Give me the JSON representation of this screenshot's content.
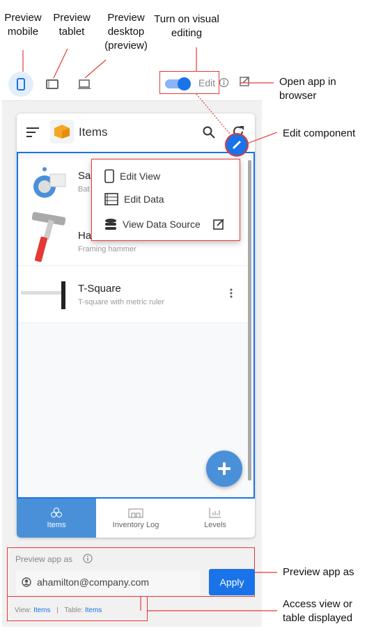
{
  "annotations": {
    "preview_mobile": "Preview mobile",
    "preview_tablet": "Preview tablet",
    "preview_desktop": "Preview desktop (preview)",
    "visual_editing": "Turn on visual editing",
    "open_in_browser": "Open app in browser",
    "edit_component": "Edit component",
    "preview_app_as": "Preview app as",
    "access_view": "Access view or table displayed"
  },
  "toolbar": {
    "edit_label": "Edit",
    "edit_toggle_on": true,
    "accent": "#1a73e8"
  },
  "app": {
    "title": "Items",
    "rows": [
      {
        "title": "Sa",
        "subtitle": "Bat"
      },
      {
        "title": "Ha",
        "subtitle": "Framing hammer"
      },
      {
        "title": "T-Square",
        "subtitle": "T-square with metric ruler"
      }
    ],
    "nav": [
      {
        "label": "Items",
        "icon": "cubes-icon",
        "active": true
      },
      {
        "label": "Inventory Log",
        "icon": "warehouse-icon",
        "active": false
      },
      {
        "label": "Levels",
        "icon": "bar-chart-icon",
        "active": false
      }
    ]
  },
  "menu": {
    "items": [
      "Edit View",
      "Edit Data",
      "View Data Source"
    ]
  },
  "preview_as": {
    "label": "Preview app as",
    "email": "ahamilton@company.com",
    "apply": "Apply"
  },
  "footer": {
    "view_label": "View:",
    "view_value": "Items",
    "sep": "|",
    "table_label": "Table:",
    "table_value": "Items"
  }
}
